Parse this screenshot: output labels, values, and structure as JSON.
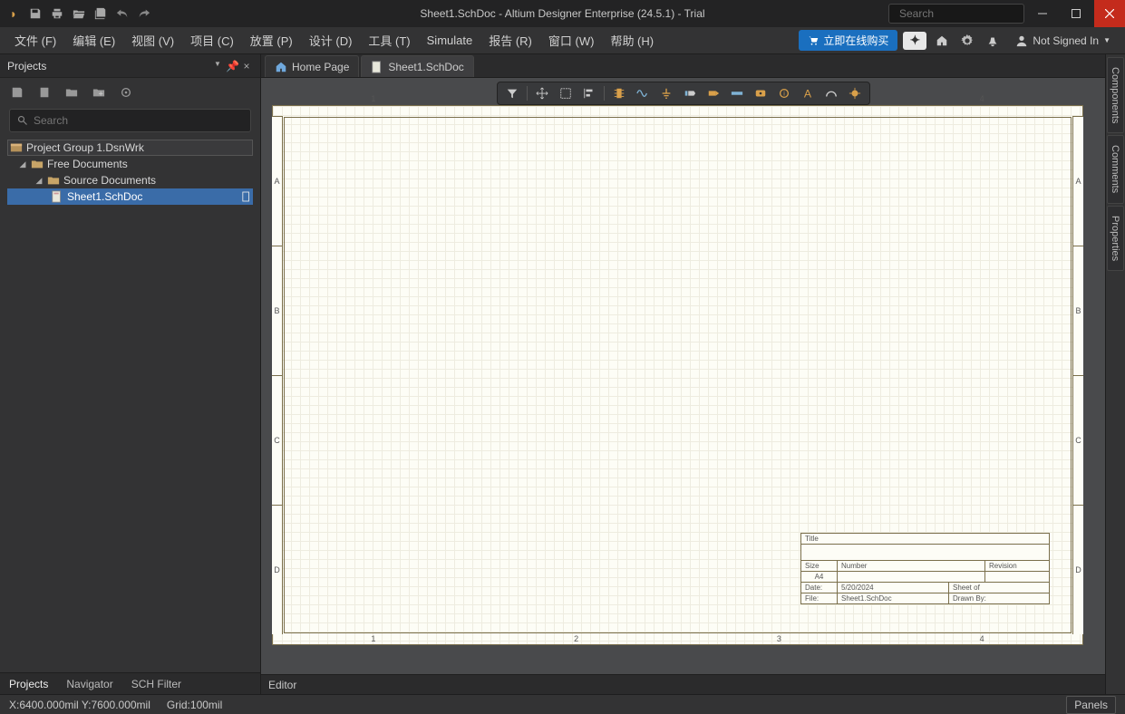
{
  "title": "Sheet1.SchDoc - Altium Designer Enterprise (24.5.1) - Trial",
  "topSearchPlaceholder": "Search",
  "menu": {
    "file": "文件 (F)",
    "edit": "编辑 (E)",
    "view": "视图 (V)",
    "project": "项目 (C)",
    "place": "放置 (P)",
    "design": "设计 (D)",
    "tools": "工具 (T)",
    "simulate": "Simulate",
    "reports": "报告 (R)",
    "window": "窗口 (W)",
    "help": "帮助 (H)"
  },
  "buyNow": "立即在线购买",
  "signIn": "Not Signed In",
  "projects": {
    "title": "Projects",
    "searchPlaceholder": "Search",
    "group": "Project Group 1.DsnWrk",
    "free": "Free Documents",
    "source": "Source Documents",
    "doc": "Sheet1.SchDoc"
  },
  "quickTabs": {
    "projects": "Projects",
    "navigator": "Navigator",
    "schFilter": "SCH Filter"
  },
  "docTabs": {
    "home": "Home Page",
    "sheet": "Sheet1.SchDoc"
  },
  "rightTabs": {
    "components": "Components",
    "comments": "Comments",
    "properties": "Properties"
  },
  "rulerTop": {
    "c1": "1",
    "c2": "2",
    "c3": "3",
    "c4": "4"
  },
  "rulerSide": {
    "a": "A",
    "b": "B",
    "c": "C",
    "d": "D"
  },
  "titleBlock": {
    "titleLabel": "Title",
    "sizeLabel": "Size",
    "sizeVal": "A4",
    "numberLabel": "Number",
    "revisionLabel": "Revision",
    "dateLabel": "Date:",
    "dateVal": "5/20/2024",
    "sheetLabel": "Sheet   of",
    "fileLabel": "File:",
    "fileVal": "Sheet1.SchDoc",
    "drawnLabel": "Drawn By:"
  },
  "editorFooter": "Editor",
  "status": {
    "coords": "X:6400.000mil Y:7600.000mil",
    "grid": "Grid:100mil",
    "panels": "Panels"
  }
}
